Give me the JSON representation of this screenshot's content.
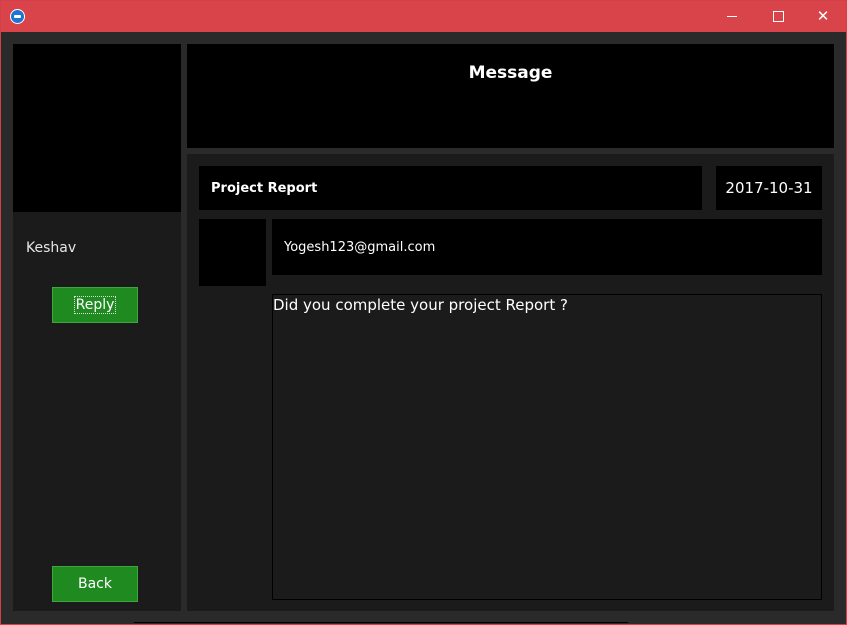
{
  "window": {
    "controls": {
      "minimize": "minimize",
      "maximize": "maximize",
      "close": "✕"
    }
  },
  "header": {
    "title": "Message"
  },
  "sidebar": {
    "sender_name": "Keshav",
    "reply_label": "Reply",
    "back_label": "Back"
  },
  "message": {
    "subject": "Project Report",
    "date": "2017-10-31",
    "from_email": "Yogesh123@gmail.com",
    "body": "Did you complete your project Report ?"
  },
  "colors": {
    "titlebar": "#d9434a",
    "button_green": "#1f8a20",
    "panel_dark": "#1b1b1b",
    "panel_black": "#000000"
  }
}
